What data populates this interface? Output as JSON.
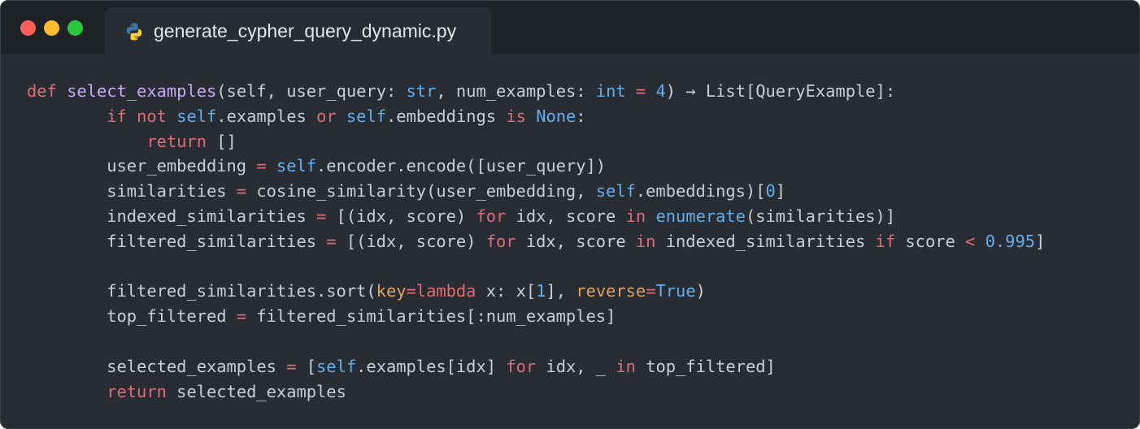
{
  "window": {
    "traffic_lights": [
      {
        "name": "close",
        "color": "#ff5f57"
      },
      {
        "name": "minimize",
        "color": "#febc2e"
      },
      {
        "name": "zoom",
        "color": "#28c840"
      }
    ],
    "tab": {
      "icon": "python-icon",
      "title": "generate_cypher_query_dynamic.py"
    }
  },
  "colors": {
    "background": "#282c33",
    "titlebar": "#1f2226",
    "keyword": "#e06c75",
    "function": "#c8a8f5",
    "builtin": "#61afef",
    "param": "#e5a05c",
    "text": "#c9ced6"
  },
  "code": {
    "language": "python",
    "lines": [
      [
        {
          "t": "def",
          "c": "kw"
        },
        {
          "t": " "
        },
        {
          "t": "select_examples",
          "c": "fn"
        },
        {
          "t": "(self, user_query: "
        },
        {
          "t": "str",
          "c": "bi"
        },
        {
          "t": ", num_examples: "
        },
        {
          "t": "int",
          "c": "bi"
        },
        {
          "t": " "
        },
        {
          "t": "=",
          "c": "op"
        },
        {
          "t": " "
        },
        {
          "t": "4",
          "c": "num"
        },
        {
          "t": ") → List[QueryExample]:"
        }
      ],
      [
        {
          "t": "        "
        },
        {
          "t": "if",
          "c": "kw"
        },
        {
          "t": " "
        },
        {
          "t": "not",
          "c": "kw"
        },
        {
          "t": " "
        },
        {
          "t": "self",
          "c": "slf"
        },
        {
          "t": ".examples "
        },
        {
          "t": "or",
          "c": "kw"
        },
        {
          "t": " "
        },
        {
          "t": "self",
          "c": "slf"
        },
        {
          "t": ".embeddings "
        },
        {
          "t": "is",
          "c": "kw"
        },
        {
          "t": " "
        },
        {
          "t": "None",
          "c": "bi"
        },
        {
          "t": ":"
        }
      ],
      [
        {
          "t": "            "
        },
        {
          "t": "return",
          "c": "kw"
        },
        {
          "t": " []"
        }
      ],
      [
        {
          "t": "        user_embedding "
        },
        {
          "t": "=",
          "c": "op"
        },
        {
          "t": " "
        },
        {
          "t": "self",
          "c": "slf"
        },
        {
          "t": ".encoder.encode([user_query])"
        }
      ],
      [
        {
          "t": "        similarities "
        },
        {
          "t": "=",
          "c": "op"
        },
        {
          "t": " cosine_similarity(user_embedding, "
        },
        {
          "t": "self",
          "c": "slf"
        },
        {
          "t": ".embeddings)["
        },
        {
          "t": "0",
          "c": "num"
        },
        {
          "t": "]"
        }
      ],
      [
        {
          "t": "        indexed_similarities "
        },
        {
          "t": "=",
          "c": "op"
        },
        {
          "t": " [(idx, score) "
        },
        {
          "t": "for",
          "c": "kw"
        },
        {
          "t": " idx, score "
        },
        {
          "t": "in",
          "c": "kw"
        },
        {
          "t": " "
        },
        {
          "t": "enumerate",
          "c": "bi"
        },
        {
          "t": "(similarities)]"
        }
      ],
      [
        {
          "t": "        filtered_similarities "
        },
        {
          "t": "=",
          "c": "op"
        },
        {
          "t": " [(idx, score) "
        },
        {
          "t": "for",
          "c": "kw"
        },
        {
          "t": " idx, score "
        },
        {
          "t": "in",
          "c": "kw"
        },
        {
          "t": " indexed_similarities "
        },
        {
          "t": "if",
          "c": "kw"
        },
        {
          "t": " score "
        },
        {
          "t": "<",
          "c": "op"
        },
        {
          "t": " "
        },
        {
          "t": "0.995",
          "c": "num"
        },
        {
          "t": "]"
        }
      ],
      [],
      [
        {
          "t": "        filtered_similarities.sort("
        },
        {
          "t": "key",
          "c": "pm"
        },
        {
          "t": "=",
          "c": "op"
        },
        {
          "t": "lambda",
          "c": "kw"
        },
        {
          "t": " x: x["
        },
        {
          "t": "1",
          "c": "num"
        },
        {
          "t": "], "
        },
        {
          "t": "reverse",
          "c": "pm"
        },
        {
          "t": "=",
          "c": "op"
        },
        {
          "t": "True",
          "c": "bi"
        },
        {
          "t": ")"
        }
      ],
      [
        {
          "t": "        top_filtered "
        },
        {
          "t": "=",
          "c": "op"
        },
        {
          "t": " filtered_similarities[:num_examples]"
        }
      ],
      [],
      [
        {
          "t": "        selected_examples "
        },
        {
          "t": "=",
          "c": "op"
        },
        {
          "t": " ["
        },
        {
          "t": "self",
          "c": "slf"
        },
        {
          "t": ".examples[idx] "
        },
        {
          "t": "for",
          "c": "kw"
        },
        {
          "t": " idx, _ "
        },
        {
          "t": "in",
          "c": "kw"
        },
        {
          "t": " top_filtered]"
        }
      ],
      [
        {
          "t": "        "
        },
        {
          "t": "return",
          "c": "kw"
        },
        {
          "t": " selected_examples"
        }
      ]
    ]
  }
}
